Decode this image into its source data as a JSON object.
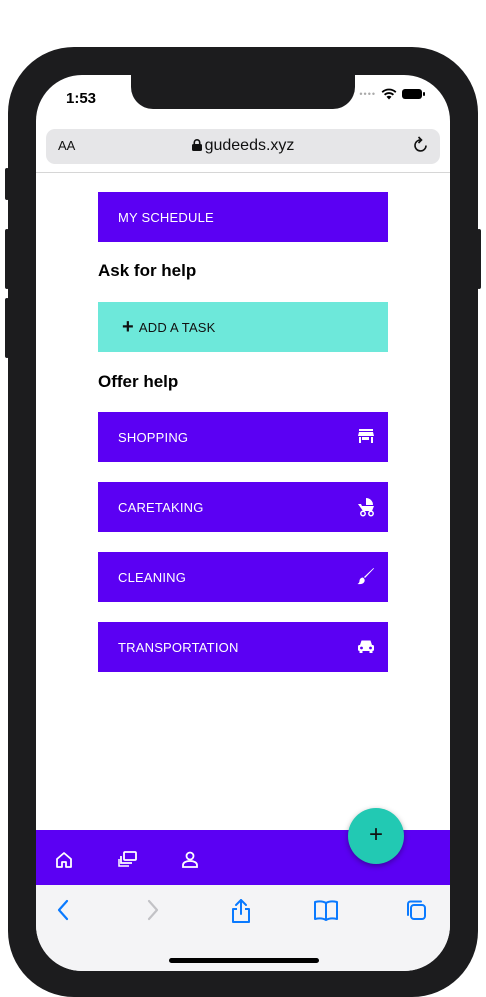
{
  "status_bar": {
    "time": "1:53"
  },
  "browser": {
    "text_size_label": "AA",
    "url": "gudeeds.xyz"
  },
  "buttons": {
    "my_schedule": "MY SCHEDULE",
    "add_task": "ADD A TASK",
    "shopping": "SHOPPING",
    "caretaking": "CARETAKING",
    "cleaning": "CLEANING",
    "transportation": "TRANSPORTATION"
  },
  "headings": {
    "ask": "Ask for help",
    "offer": "Offer help"
  },
  "fab": {
    "label": "+"
  },
  "colors": {
    "primary": "#5b00f3",
    "accent": "#6de8da",
    "fab": "#22c9b3"
  },
  "icons": {
    "shopping": "store-icon",
    "caretaking": "stroller-icon",
    "cleaning": "brush-icon",
    "transportation": "car-icon"
  }
}
